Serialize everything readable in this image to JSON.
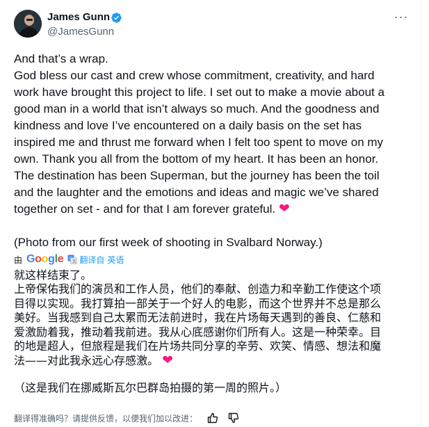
{
  "author": {
    "name": "James Gunn",
    "handle": "@JamesGunn",
    "verified": true
  },
  "menu": {
    "more_label": "···"
  },
  "tweet": {
    "lines": [
      "And that’s a wrap.",
      "God bless our cast and crew whose commitment, creativity, and hard",
      "work have brought this project to life. I set out to make a movie about a",
      "good man in a world that isn’t always so much. And the goodness and",
      "kindness and love I’ve encountered on a daily basis on the set has",
      "inspired me and thrust me forward when I felt too spent to move on my",
      "own. Thank you all from the bottom of my heart. It has been an honor.",
      "The destination has been Superman, but the journey has been the toil",
      "and the laughter and the emotions and ideas and magic we’ve shared",
      "together on set - and for that I am forever grateful. "
    ],
    "heart": "❤",
    "photo_note": "(Photo from our first week of shooting in Svalbard Norway.)"
  },
  "translation_bar": {
    "by": "由",
    "google": "Google",
    "translated_label": "翻译自",
    "source_language": "英语"
  },
  "translation": {
    "lines": [
      "就这样结束了。",
      "上帝保佑我们的演员和工作人员，他们的奉献、创造力和辛勤工作使这个项",
      "目得以实现。我打算拍一部关于一个好人的电影，而这个世界并不总是那么",
      "美好。当我感到自己太累而无法前进时，我在片场每天遇到的善良、仁慈和",
      "爱激励着我，推动着我前进。我从心底感谢你们所有人。这是一种荣幸。目",
      "的地是超人，但旅程是我们在片场共同分享的辛劳、欢笑、情感、想法和魔",
      "法——对此我永远心存感激。 "
    ],
    "heart": "❤",
    "photo_note": "（这是我们在挪威斯瓦尔巴群岛拍摄的第一周的照片。）"
  },
  "feedback": {
    "prompt": "翻译得准确吗？请提供反馈，以便我们加以改进："
  },
  "colors": {
    "accent": "#1d9bf0",
    "heart": "#f91880",
    "muted": "#536471"
  },
  "icons": [
    "verified-badge-icon",
    "more-options-icon",
    "google-translate-icon",
    "thumbs-up-icon",
    "thumbs-down-icon"
  ]
}
